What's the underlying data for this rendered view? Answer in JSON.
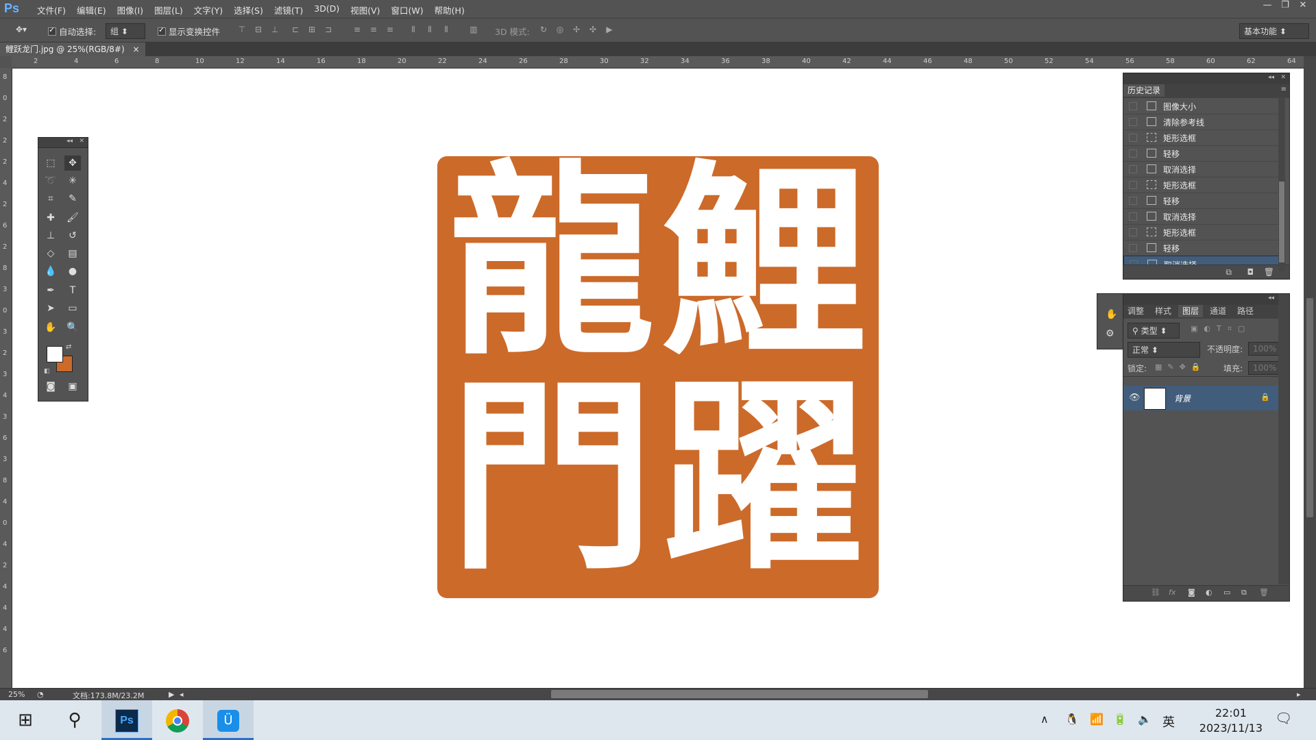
{
  "app": {
    "logo": "Ps",
    "menu": [
      "文件(F)",
      "编辑(E)",
      "图像(I)",
      "图层(L)",
      "文字(Y)",
      "选择(S)",
      "滤镜(T)",
      "3D(D)",
      "视图(V)",
      "窗口(W)",
      "帮助(H)"
    ],
    "window_controls": [
      "—",
      "❐",
      "✕"
    ]
  },
  "options_bar": {
    "auto_select_label": "自动选择:",
    "auto_select_value": "组",
    "show_transform_label": "显示变换控件",
    "mode_3d_label": "3D 模式:",
    "workspace": "基本功能"
  },
  "document": {
    "tab_title": "鲤跃龙门.jpg @ 25%(RGB/8#)",
    "tab_close": "×"
  },
  "rulers": {
    "h_ticks": [
      "2",
      "4",
      "6",
      "8",
      "10",
      "12",
      "14",
      "16",
      "18",
      "20",
      "22",
      "24",
      "26",
      "28",
      "30",
      "32",
      "34",
      "36",
      "38",
      "40",
      "42",
      "44",
      "46",
      "48",
      "50",
      "52",
      "54",
      "56",
      "58",
      "60",
      "62",
      "64"
    ],
    "v_ticks": [
      "8",
      "0",
      "2",
      "2",
      "2",
      "4",
      "2",
      "6",
      "2",
      "8",
      "3",
      "0",
      "3",
      "2",
      "3",
      "4",
      "3",
      "6",
      "3",
      "8",
      "4",
      "0",
      "4",
      "2",
      "4",
      "4",
      "4",
      "6"
    ]
  },
  "seal": {
    "color": "#cc6a2a",
    "characters": [
      "龍",
      "鯉",
      "門",
      "躍"
    ]
  },
  "history_panel": {
    "title": "历史记录",
    "items": [
      {
        "label": "图像大小",
        "icon": "doc",
        "selected": false
      },
      {
        "label": "清除参考线",
        "icon": "doc",
        "selected": false
      },
      {
        "label": "矩形选框",
        "icon": "marquee",
        "selected": false
      },
      {
        "label": "轻移",
        "icon": "doc",
        "selected": false
      },
      {
        "label": "取消选择",
        "icon": "doc",
        "selected": false
      },
      {
        "label": "矩形选框",
        "icon": "marquee",
        "selected": false
      },
      {
        "label": "轻移",
        "icon": "doc",
        "selected": false
      },
      {
        "label": "取消选择",
        "icon": "doc",
        "selected": false
      },
      {
        "label": "矩形选框",
        "icon": "marquee",
        "selected": false
      },
      {
        "label": "轻移",
        "icon": "doc",
        "selected": false
      },
      {
        "label": "取消选择",
        "icon": "doc",
        "selected": true
      }
    ]
  },
  "layers_panel": {
    "tabs": [
      "调整",
      "样式",
      "图层",
      "通道",
      "路径"
    ],
    "active_tab": "图层",
    "filter_label": "类型",
    "blend_mode": "正常",
    "opacity_label": "不透明度:",
    "opacity_value": "100%",
    "lock_label": "锁定:",
    "fill_label": "填充:",
    "fill_value": "100%",
    "layers": [
      {
        "name": "背景",
        "locked": true,
        "visible": true
      }
    ]
  },
  "status_bar": {
    "zoom": "25%",
    "doc_info": "文档:173.8M/23.2M"
  },
  "taskbar": {
    "apps": [
      {
        "name": "windows-start",
        "glyph": "⊞"
      },
      {
        "name": "search",
        "glyph": "⚲"
      },
      {
        "name": "photoshop",
        "glyph": "Ps"
      },
      {
        "name": "chrome",
        "glyph": "◉"
      },
      {
        "name": "app-blue",
        "glyph": "Ü"
      }
    ],
    "ime": "英",
    "time": "22:01",
    "date": "2023/11/13"
  }
}
